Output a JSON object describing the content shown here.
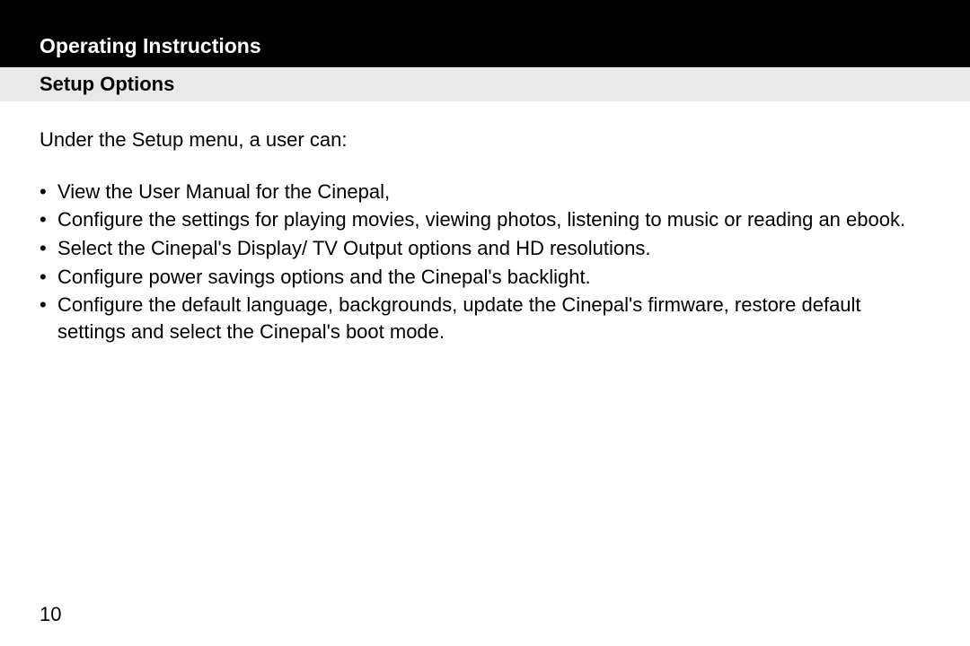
{
  "header": {
    "title": "Operating Instructions"
  },
  "subheader": {
    "title": "Setup Options"
  },
  "content": {
    "intro": "Under the Setup menu, a user can:",
    "bullets": [
      "View the User Manual for the Cinepal,",
      "Configure the settings for playing movies, viewing photos, listening to music or reading an ebook.",
      "Select the Cinepal's Display/ TV Output options and HD resolutions.",
      "Configure power savings options and the Cinepal's backlight.",
      "Configure the default language, backgrounds, update the Cinepal's firmware, restore default settings and select the Cinepal's boot mode."
    ]
  },
  "page_number": "10"
}
